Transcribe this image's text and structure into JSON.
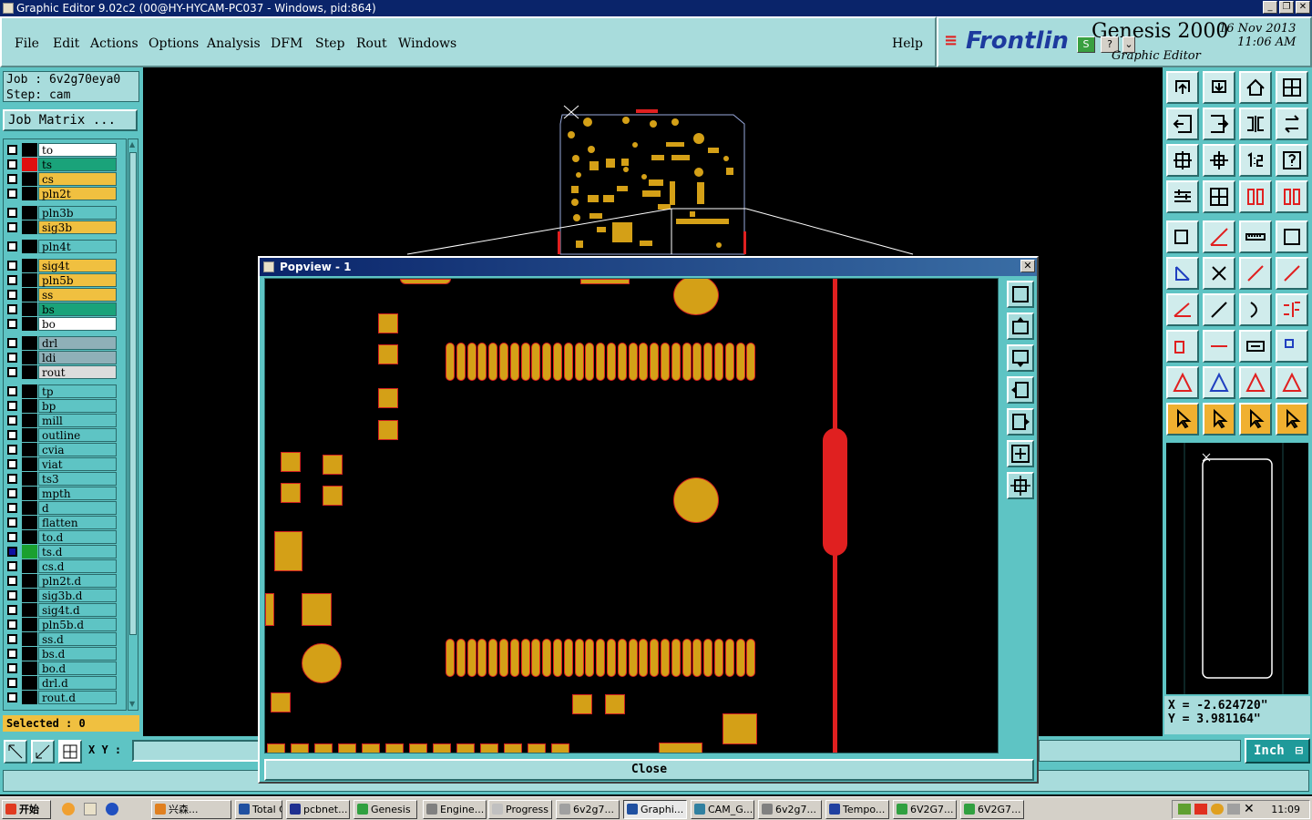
{
  "window": {
    "title": "Graphic Editor 9.02c2 (00@HY-HYCAM-PC037 - Windows, pid:864)"
  },
  "menu": {
    "items": [
      "File",
      "Edit",
      "Actions",
      "Options",
      "Analysis",
      "DFM",
      "Step",
      "Rout",
      "Windows"
    ],
    "help": "Help"
  },
  "brand": {
    "logo": "Frontlin",
    "product": "Genesis 2000",
    "subtitle": "Graphic Editor",
    "date": "16  Nov  2013",
    "time": "11:06  AM",
    "s_btn": "S",
    "q_btn": "?"
  },
  "job": {
    "job_line": "Job  :  6v2g70eya0",
    "step_line": "Step:  cam",
    "matrix_button": "Job Matrix ..."
  },
  "layers": [
    {
      "name": "to",
      "color": "#ffffff",
      "swatch": "#000000"
    },
    {
      "name": "ts",
      "color": "#1aa37a",
      "swatch": "#e01010"
    },
    {
      "name": "cs",
      "color": "#f0c040",
      "swatch": "#000000"
    },
    {
      "name": "pln2t",
      "color": "#f0c040",
      "swatch": "#000000"
    },
    {
      "name": "pln3b",
      "color": "#5ec4c4",
      "swatch": "#000000"
    },
    {
      "name": "sig3b",
      "color": "#f0c040",
      "swatch": "#000000"
    },
    {
      "name": "pln4t",
      "color": "#5ec4c4",
      "swatch": "#000000"
    },
    {
      "name": "sig4t",
      "color": "#f0c040",
      "swatch": "#000000"
    },
    {
      "name": "pln5b",
      "color": "#f0c040",
      "swatch": "#000000"
    },
    {
      "name": "ss",
      "color": "#f0c040",
      "swatch": "#000000"
    },
    {
      "name": "bs",
      "color": "#1aa37a",
      "swatch": "#000000"
    },
    {
      "name": "bo",
      "color": "#ffffff",
      "swatch": "#000000"
    },
    {
      "name": "drl",
      "color": "#8fb0b8",
      "swatch": "#000000"
    },
    {
      "name": "ldi",
      "color": "#8fb0b8",
      "swatch": "#000000"
    },
    {
      "name": "rout",
      "color": "#dcdcdc",
      "swatch": "#000000"
    },
    {
      "name": "tp",
      "color": "#5ec4c4",
      "swatch": "#000000"
    },
    {
      "name": "bp",
      "color": "#5ec4c4",
      "swatch": "#000000"
    },
    {
      "name": "mill",
      "color": "#5ec4c4",
      "swatch": "#000000"
    },
    {
      "name": "outline",
      "color": "#5ec4c4",
      "swatch": "#000000"
    },
    {
      "name": "cvia",
      "color": "#5ec4c4",
      "swatch": "#000000"
    },
    {
      "name": "viat",
      "color": "#5ec4c4",
      "swatch": "#000000"
    },
    {
      "name": "ts3",
      "color": "#5ec4c4",
      "swatch": "#000000"
    },
    {
      "name": "mpth",
      "color": "#5ec4c4",
      "swatch": "#000000"
    },
    {
      "name": "d",
      "color": "#5ec4c4",
      "swatch": "#000000"
    },
    {
      "name": "flatten",
      "color": "#5ec4c4",
      "swatch": "#000000"
    },
    {
      "name": "to.d",
      "color": "#5ec4c4",
      "swatch": "#000000"
    },
    {
      "name": "ts.d",
      "color": "#5ec4c4",
      "swatch": "#1aa030"
    },
    {
      "name": "cs.d",
      "color": "#5ec4c4",
      "swatch": "#000000"
    },
    {
      "name": "pln2t.d",
      "color": "#5ec4c4",
      "swatch": "#000000"
    },
    {
      "name": "sig3b.d",
      "color": "#5ec4c4",
      "swatch": "#000000"
    },
    {
      "name": "sig4t.d",
      "color": "#5ec4c4",
      "swatch": "#000000"
    },
    {
      "name": "pln5b.d",
      "color": "#5ec4c4",
      "swatch": "#000000"
    },
    {
      "name": "ss.d",
      "color": "#5ec4c4",
      "swatch": "#000000"
    },
    {
      "name": "bs.d",
      "color": "#5ec4c4",
      "swatch": "#000000"
    },
    {
      "name": "bo.d",
      "color": "#5ec4c4",
      "swatch": "#000000"
    },
    {
      "name": "drl.d",
      "color": "#5ec4c4",
      "swatch": "#000000"
    },
    {
      "name": "rout.d",
      "color": "#5ec4c4",
      "swatch": "#000000"
    }
  ],
  "selected": "Selected : 0",
  "xy": {
    "label": "X Y :",
    "value": ""
  },
  "units": "Inch",
  "coords": {
    "x": "X = -2.624720\"",
    "y": "Y = 3.981164\""
  },
  "popview": {
    "title": "Popview - 1",
    "close": "Close"
  },
  "taskbar": {
    "start": "开始",
    "tasks": [
      "兴森...",
      "Total C...",
      "pcbnet...",
      "Genesis",
      "Engine...",
      "Progress",
      "6v2g7...",
      "Graphi...",
      "CAM_G...",
      "6v2g7...",
      "Tempo...",
      "6V2G7...",
      "6V2G7..."
    ],
    "clock": "11:09"
  }
}
